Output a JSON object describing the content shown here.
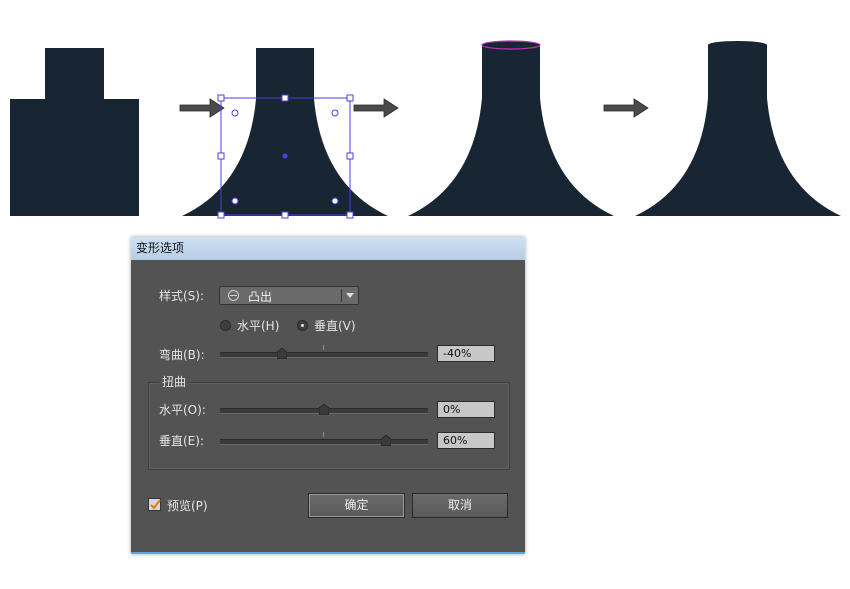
{
  "dialog": {
    "title": "变形选项",
    "style_label": "样式(S):",
    "style_value": "凸出",
    "orientation": {
      "horizontal_label": "水平(H)",
      "vertical_label": "垂直(V)",
      "selected": "vertical"
    },
    "bend": {
      "label": "弯曲(B):",
      "value_text": "-40%",
      "value": -40
    },
    "distortion": {
      "group_label": "扭曲",
      "horizontal": {
        "label": "水平(O):",
        "value_text": "0%",
        "value": 0
      },
      "vertical": {
        "label": "垂直(E):",
        "value_text": "60%",
        "value": 60
      }
    },
    "preview": {
      "label": "预览(P)",
      "checked": true
    },
    "ok_label": "确定",
    "cancel_label": "取消"
  },
  "colors": {
    "shape_fill": "#182633",
    "selection_blue": "#4b3fe0",
    "ellipse_magenta": "#c030c0",
    "dialog_bg": "#535353",
    "checkbox_orange": "#e07a1f"
  },
  "icons": [
    "arrow-right-icon",
    "bulge-style-icon",
    "dropdown-arrow-icon",
    "checkmark-icon"
  ]
}
